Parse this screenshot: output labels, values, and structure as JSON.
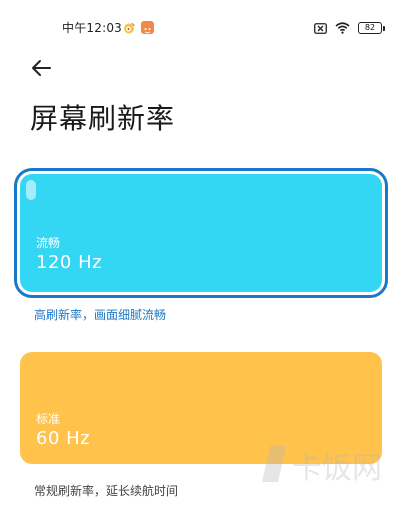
{
  "status_bar": {
    "time": "中午12:03",
    "battery": "82",
    "icons": [
      "weibo-icon",
      "app-notification-icon",
      "sim-off-icon",
      "wifi-icon",
      "battery-icon"
    ]
  },
  "nav": {
    "back_icon": "back-arrow-icon"
  },
  "page": {
    "title": "屏幕刷新率"
  },
  "options": [
    {
      "name": "流畅",
      "value": "120 Hz",
      "description": "高刷新率，画面细腻流畅",
      "color": "#33d7f4",
      "selected": true
    },
    {
      "name": "标准",
      "value": "60 Hz",
      "description": "常规刷新率，延长续航时间",
      "color": "#ffc24a",
      "selected": false
    }
  ],
  "watermark": "卡饭网",
  "colors": {
    "selected_outline": "#1a78c8",
    "selected_description": "#1a78c8"
  }
}
